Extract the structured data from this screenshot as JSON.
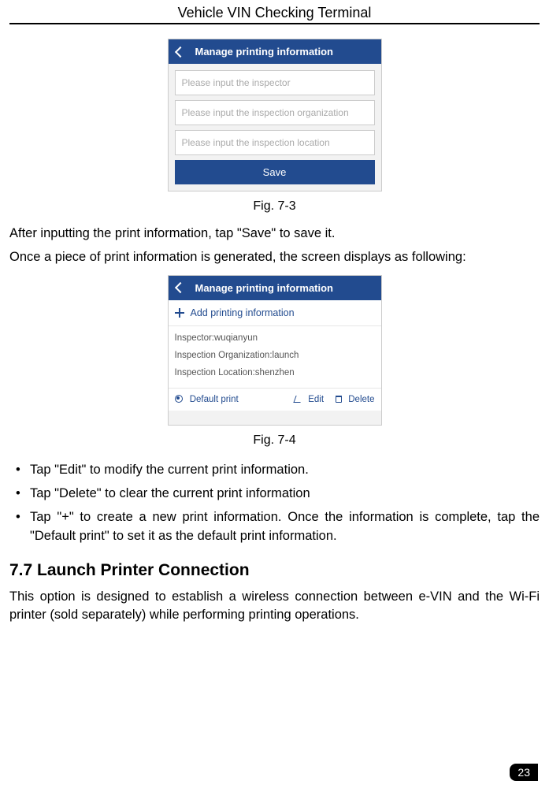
{
  "header": {
    "title": "Vehicle VIN Checking Terminal"
  },
  "fig1": {
    "bar_title": "Manage printing information",
    "input1": "Please input the inspector",
    "input2": "Please input the inspection organization",
    "input3": "Please input the inspection location",
    "save": "Save",
    "caption": "Fig. 7-3"
  },
  "para1": "After inputting the print information, tap \"Save\" to save it.",
  "para2": "Once a piece of print information is generated, the screen displays as following:",
  "fig2": {
    "bar_title": "Manage printing information",
    "add": "Add printing information",
    "line1": "Inspector:wuqianyun",
    "line2": "Inspection Organization:launch",
    "line3": "Inspection Location:shenzhen",
    "default": "Default print",
    "edit": "Edit",
    "delete": "Delete",
    "caption": "Fig. 7-4"
  },
  "bullets": {
    "b1": "Tap \"Edit\" to modify the current print information.",
    "b2": "Tap \"Delete\" to clear the current print information",
    "b3": "Tap \"+\" to create a new print information. Once the information is complete, tap the \"Default print\" to set it as the default print information."
  },
  "section": {
    "heading": "7.7 Launch Printer Connection"
  },
  "para3": "This option is designed to establish a wireless connection between e-VIN and the Wi-Fi printer (sold separately) while performing printing operations.",
  "page_number": "23"
}
